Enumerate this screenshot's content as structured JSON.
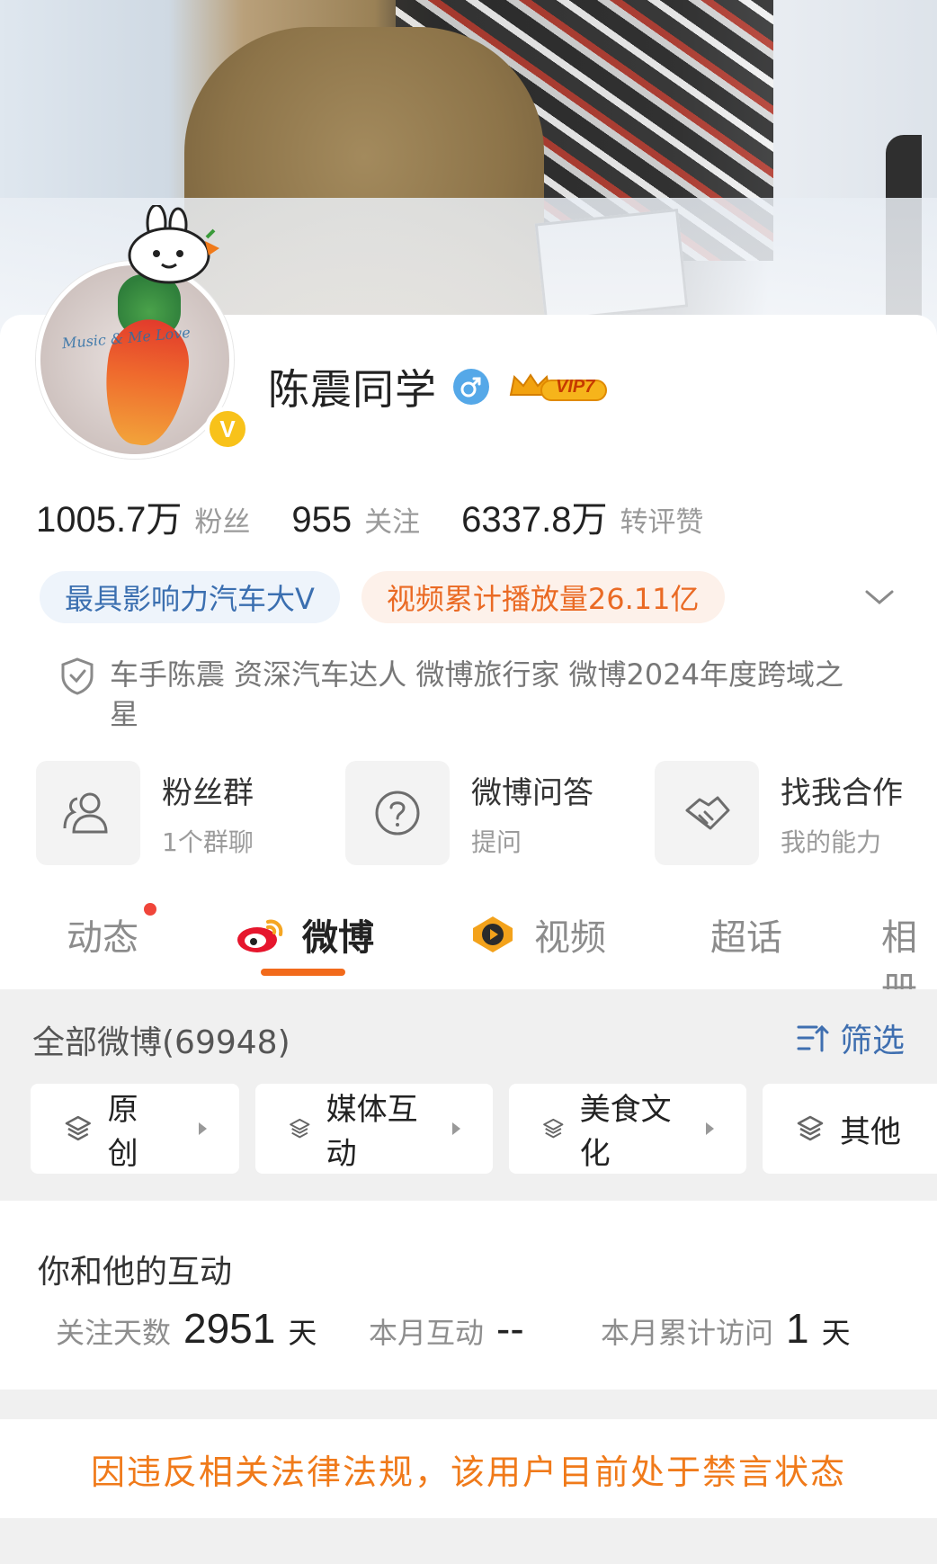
{
  "profile": {
    "name": "陈震同学",
    "vip_label": "VIP7",
    "verified_badge": "V",
    "avatar_script_text": "Music & Me Love"
  },
  "stats": [
    {
      "value": "1005.7万",
      "label": "粉丝"
    },
    {
      "value": "955",
      "label": "关注"
    },
    {
      "value": "6337.8万",
      "label": "转评赞"
    }
  ],
  "tags": [
    {
      "text": "最具影响力汽车大V"
    },
    {
      "text": "视频累计播放量26.11亿"
    }
  ],
  "verification": {
    "text": "车手陈震 资深汽车达人 微博旅行家 微博2024年度跨域之星"
  },
  "services": [
    {
      "title": "粉丝群",
      "subtitle": "1个群聊",
      "icon": "users-icon"
    },
    {
      "title": "微博问答",
      "subtitle": "提问",
      "icon": "question-icon"
    },
    {
      "title": "找我合作",
      "subtitle": "我的能力",
      "icon": "handshake-icon"
    }
  ],
  "tabs": [
    {
      "label": "动态"
    },
    {
      "label": "微博"
    },
    {
      "label": "视频"
    },
    {
      "label": "超话"
    },
    {
      "label": "相册"
    }
  ],
  "weibo_section": {
    "all_label": "全部微博(69948)",
    "filter_label": "筛选",
    "chips": [
      "原创",
      "媒体互动",
      "美食文化",
      "其他"
    ]
  },
  "interaction": {
    "title": "你和他的互动",
    "items": [
      {
        "key": "关注天数",
        "value": "2951",
        "unit": "天"
      },
      {
        "key": "本月互动",
        "value": "--",
        "unit": ""
      },
      {
        "key": "本月累计访问",
        "value": "1",
        "unit": "天"
      }
    ]
  },
  "ban_notice": "因违反相关法律法规，该用户目前处于禁言状态",
  "colors": {
    "accent_orange": "#f26a1b",
    "tag_blue": "#3b6fb0",
    "tag_orange": "#ea6a24",
    "vip_gold": "#f8c21a",
    "gender_blue": "#55a8e8"
  }
}
